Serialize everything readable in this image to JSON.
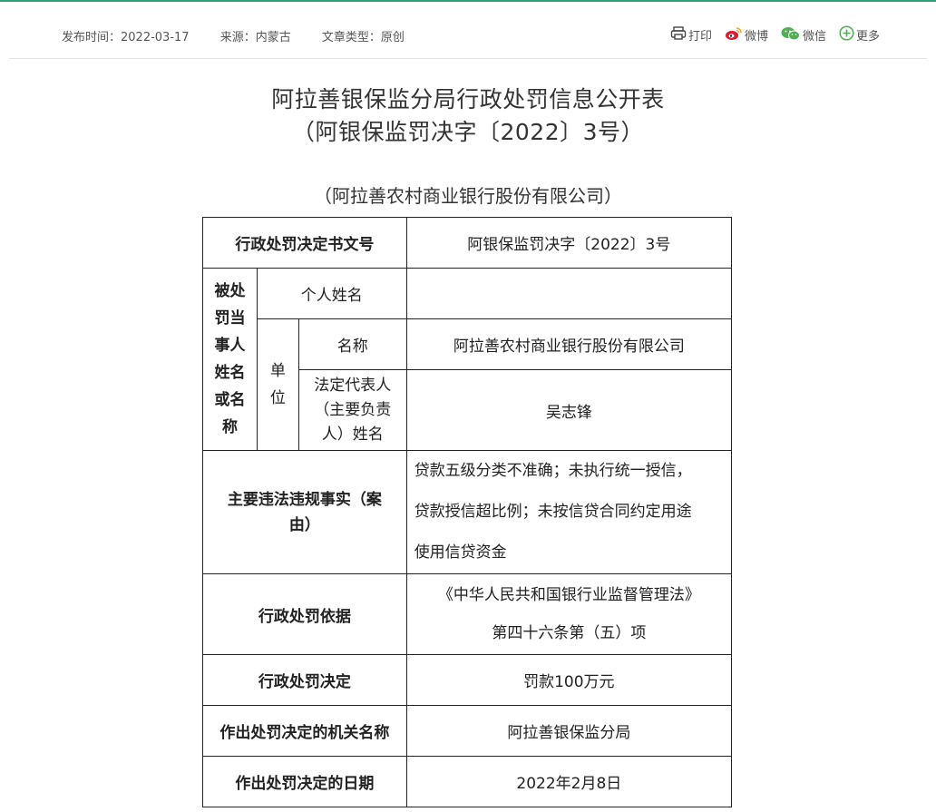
{
  "meta": {
    "publish_time": "发布时间：2022-03-17",
    "source": "来源：内蒙古",
    "article_type": "文章类型：原创"
  },
  "share": {
    "print": "打印",
    "weibo": "微博",
    "wechat": "微信",
    "more": "更多"
  },
  "title_line1": "阿拉善银保监分局行政处罚信息公开表",
  "title_line2": "（阿银保监罚决字〔2022〕3号）",
  "subtitle": "（阿拉善农村商业银行股份有限公司）",
  "table": {
    "doc_no_label": "行政处罚决定书文号",
    "doc_no_value": "阿银保监罚决字〔2022〕3号",
    "party_label_lines": [
      "被处",
      "罚当",
      "事人",
      "姓名",
      "或名",
      "称"
    ],
    "personal_name_label": "个人姓名",
    "personal_name_value": "",
    "unit_label_lines": [
      "单",
      "位"
    ],
    "unit_name_label": "名称",
    "unit_name_value": "阿拉善农村商业银行股份有限公司",
    "legal_rep_label_lines": [
      "法定代表人",
      "（主要负责",
      "人）姓名"
    ],
    "legal_rep_value": "吴志锋",
    "facts_label_lines": [
      "主要违法违规事实（案",
      "由）"
    ],
    "facts_value_lines": [
      "贷款五级分类不准确；未执行统一授信，",
      "贷款授信超比例；未按信贷合同约定用途",
      "使用信贷资金"
    ],
    "basis_label": "行政处罚依据",
    "basis_value_lines": [
      "《中华人民共和国银行业监督管理法》",
      "第四十六条第（五）项"
    ],
    "decision_label": "行政处罚决定",
    "decision_value": "罚款100万元",
    "authority_label": "作出处罚决定的机关名称",
    "authority_value": "阿拉善银保监分局",
    "date_label": "作出处罚决定的日期",
    "date_value": "2022年2月8日"
  },
  "colors": {
    "accent": "#2aa37a",
    "weibo_red": "#e6162d",
    "wechat_green": "#4caf50"
  }
}
